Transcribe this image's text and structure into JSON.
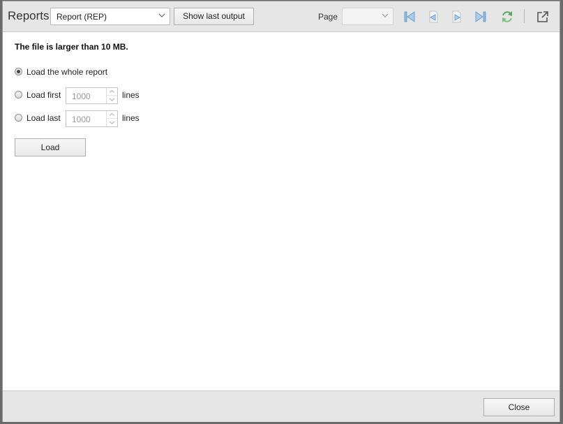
{
  "header": {
    "title": "Reports",
    "report_select": {
      "value": "Report (REP)"
    },
    "show_last_output_label": "Show last output",
    "page_label": "Page",
    "page_select": {
      "value": ""
    },
    "icons": [
      "first-page-icon",
      "previous-page-icon",
      "next-page-icon",
      "last-page-icon",
      "refresh-icon",
      "open-external-icon"
    ]
  },
  "content": {
    "message": "The file is larger than 10 MB.",
    "options": [
      {
        "label": "Load the whole report",
        "checked": true
      },
      {
        "label": "Load first",
        "value": "1000",
        "suffix": "lines",
        "checked": false
      },
      {
        "label": "Load last",
        "value": "1000",
        "suffix": "lines",
        "checked": false
      }
    ],
    "load_label": "Load"
  },
  "footer": {
    "close_label": "Close"
  },
  "colors": {
    "header_bg": "#e6e6e6",
    "nav_icon_blue": "#7aaed8",
    "refresh_green": "#5aa85a"
  }
}
